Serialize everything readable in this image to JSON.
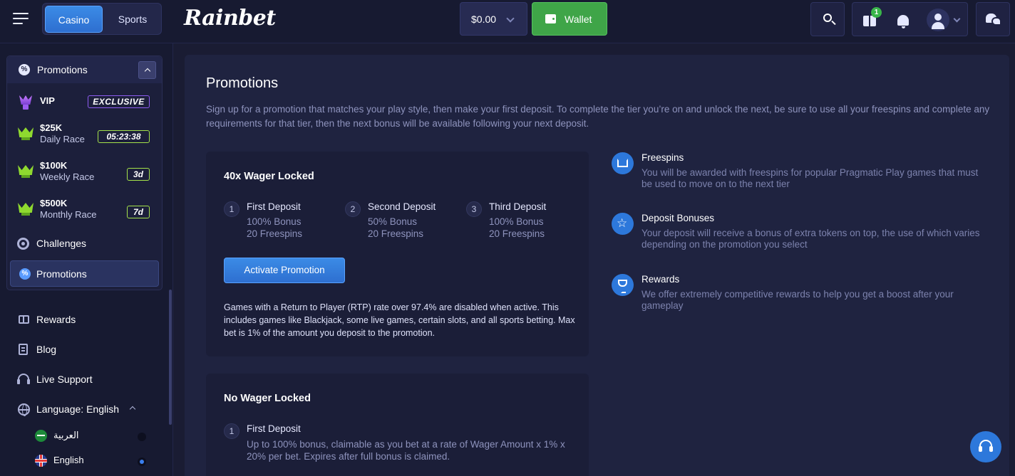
{
  "header": {
    "modes": {
      "casino": "Casino",
      "sports": "Sports"
    },
    "logo": "Rainbet",
    "balance": "$0.00",
    "wallet_label": "Wallet",
    "gift_badge_count": "1"
  },
  "sidebar": {
    "promotions_header": "Promotions",
    "vip": {
      "title": "VIP",
      "badge": "EXCLUSIVE"
    },
    "races": [
      {
        "amount": "$25K",
        "name": "Daily Race",
        "timer": "05:23:38"
      },
      {
        "amount": "$100K",
        "name": "Weekly Race",
        "timer": "3d"
      },
      {
        "amount": "$500K",
        "name": "Monthly Race",
        "timer": "7d"
      }
    ],
    "challenges": "Challenges",
    "promotions_active": "Promotions",
    "nav": {
      "rewards": "Rewards",
      "blog": "Blog",
      "live_support": "Live Support",
      "language": "Language: English"
    },
    "languages": [
      {
        "label": "العربية",
        "selected": false
      },
      {
        "label": "English",
        "selected": true
      }
    ]
  },
  "main": {
    "title": "Promotions",
    "description": "Sign up for a promotion that matches your play style, then make your first deposit. To complete the tier you’re on and unlock the next, be sure to use all your freespins and complete any requirements for that tier, then the next bonus will be available following your next deposit.",
    "promos": [
      {
        "title": "40x Wager Locked",
        "steps": [
          {
            "num": "1",
            "title": "First Deposit",
            "line1": "100% Bonus",
            "line2": "20 Freespins"
          },
          {
            "num": "2",
            "title": "Second Deposit",
            "line1": "50% Bonus",
            "line2": "20 Freespins"
          },
          {
            "num": "3",
            "title": "Third Deposit",
            "line1": "100% Bonus",
            "line2": "20 Freespins"
          }
        ],
        "button": "Activate Promotion",
        "note": "Games with a Return to Player (RTP) rate over 97.4% are disabled when active. This includes games like Blackjack, some live games, certain slots, and all sports betting. Max bet is 1% of the amount you deposit to the promotion."
      },
      {
        "title": "No Wager Locked",
        "steps": [
          {
            "num": "1",
            "title": "First Deposit",
            "desc": "Up to 100% bonus, claimable as you bet at a rate of Wager Amount x 1% x 20% per bet. Expires after full bonus is claimed."
          }
        ]
      }
    ],
    "features": [
      {
        "icon": "crown-icon",
        "title": "Freespins",
        "desc": "You will be awarded with freespins for popular Pragmatic Play games that must be used to move on to the next tier"
      },
      {
        "icon": "star-icon",
        "title": "Deposit Bonuses",
        "desc": "Your deposit will receive a bonus of extra tokens on top, the use of which varies depending on the promotion you select"
      },
      {
        "icon": "trophy-icon",
        "title": "Rewards",
        "desc": "We offer extremely competitive rewards to help you get a boost after your gameplay"
      }
    ]
  },
  "colors": {
    "accent": "#2e6fd0",
    "wallet_green": "#3fa548",
    "race_green": "#8fd92f",
    "vip_purple": "#8e5cf0",
    "background": "#1a1c33"
  }
}
